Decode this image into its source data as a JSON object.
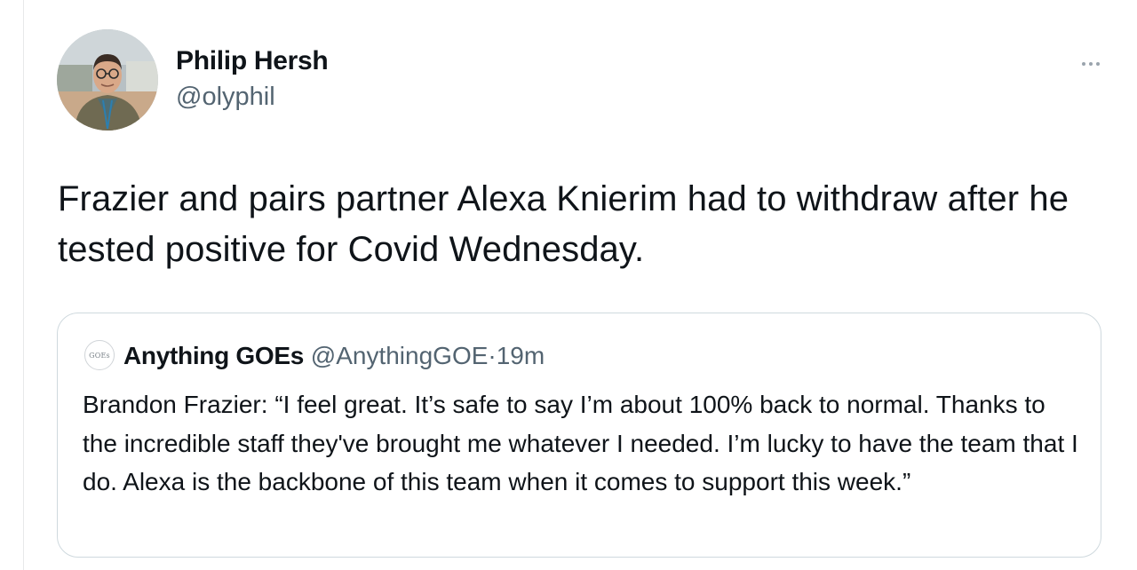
{
  "tweet": {
    "author": {
      "name": "Philip Hersh",
      "handle": "@olyphil"
    },
    "text": "Frazier and pairs partner Alexa Knierim had to withdraw after he tested positive for Covid Wednesday.",
    "more_icon": "more-horizontal-icon"
  },
  "quoted_tweet": {
    "avatar_text": "GOEs",
    "author_name": "Anything GOEs",
    "author_handle": "@AnythingGOE",
    "separator": "·",
    "time": "19m",
    "text": "Brandon Frazier: “I feel great. It’s safe to say I’m about 100% back to normal. Thanks to the incredible staff they've brought me whatever I needed. I’m lucky to have the team that I do. Alexa is the backbone of this team when it comes to support this week.”"
  },
  "colors": {
    "text_primary": "#0f1419",
    "text_secondary": "#536471",
    "border": "#cfd9de"
  }
}
